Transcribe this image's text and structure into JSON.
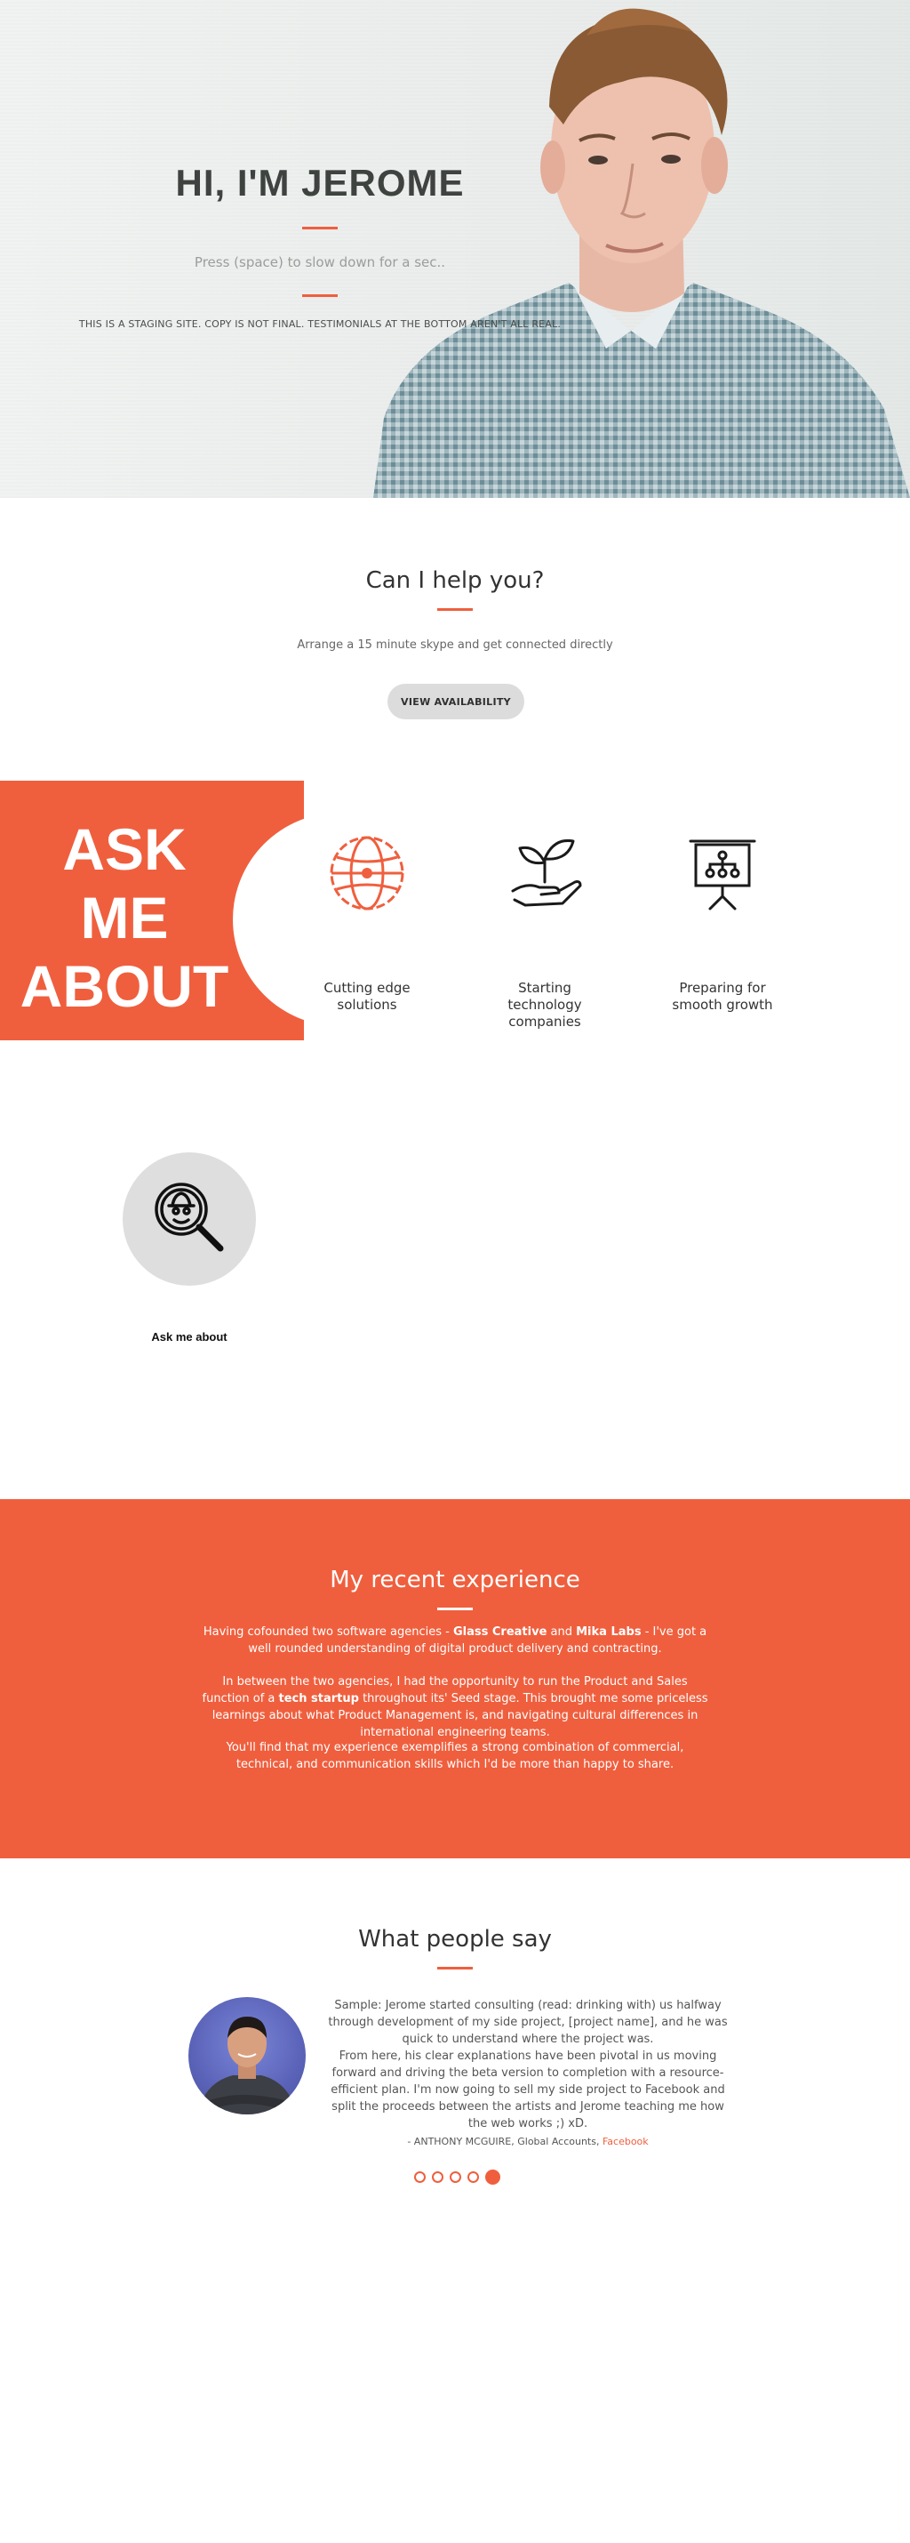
{
  "hero": {
    "title": "HI, I'M JEROME",
    "subtitle": "Press (space) to slow down for a sec..",
    "note": "THIS IS A STAGING SITE. COPY IS NOT FINAL. TESTIMONIALS AT THE BOTTOM AREN'T ALL REAL."
  },
  "help": {
    "title": "Can I help you?",
    "text": "Arrange a 15 minute skype and get connected directly",
    "button_label": "VIEW AVAILABILITY"
  },
  "ask": {
    "words": [
      "ASK",
      "ME",
      "ABOUT"
    ],
    "topics": [
      {
        "label": "Cutting edge solutions",
        "icon": "globe-icon"
      },
      {
        "label": "Starting technology companies",
        "icon": "plant-in-hand-icon"
      },
      {
        "label": "Preparing for smooth growth",
        "icon": "presentation-board-icon"
      }
    ],
    "link_label": "Ask me about",
    "link_icon": "spy-magnifier-icon"
  },
  "experience": {
    "title": "My recent experience",
    "p1_before": "Having cofounded two software agencies - ",
    "p1_b1": "Glass Creative",
    "p1_mid": " and ",
    "p1_b2": "Mika Labs",
    "p1_after": " - I've got a well rounded understanding of digital product delivery and contracting.",
    "p2_before": "In between the two agencies, I had the opportunity to run the Product and Sales function of a ",
    "p2_b": "tech startup",
    "p2_after": " throughout its' Seed stage. This brought me some priceless learnings about what Product Management is, and navigating cultural differences in international engineering teams.",
    "p3": "You'll find that my experience exemplifies a strong combination of commercial, technical, and communication skills which I'd be more than happy to share."
  },
  "testimonials": {
    "title": "What people say",
    "quote_1": "Sample: Jerome started consulting (read: drinking with) us halfway through development of my side project, [project name], and he was quick to understand where the project was.",
    "quote_2": "From here, his clear explanations have been pivotal in us moving forward and driving the beta version to completion with a resource-efficient plan. I'm now going to sell my side project to Facebook and split the proceeds between the artists and Jerome teaching me how the web works ;) xD.",
    "attribution": "- ANTHONY MCGUIRE, Global Accounts, ",
    "company": "Facebook",
    "slide_count": 5,
    "active_slide": 5
  },
  "colors": {
    "accent": "#ef5f3e",
    "button_bg": "#dcdcdc",
    "text_dark": "#333333"
  }
}
